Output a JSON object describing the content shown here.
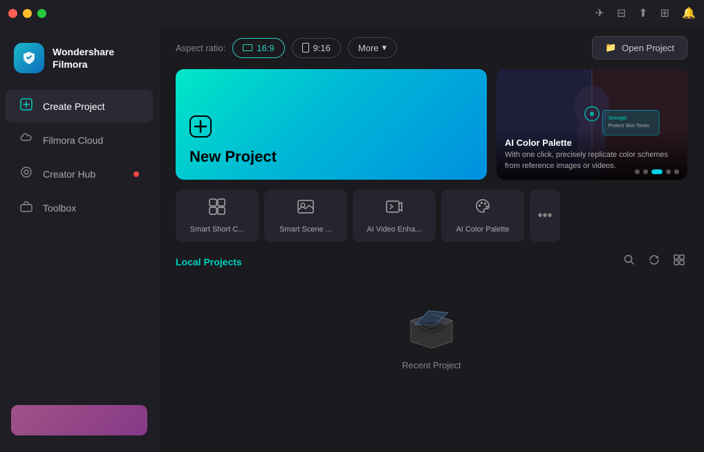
{
  "titlebar": {
    "buttons": [
      "close",
      "minimize",
      "maximize"
    ],
    "icons": [
      "send",
      "message",
      "cloud",
      "grid",
      "bell"
    ]
  },
  "sidebar": {
    "logo": {
      "text_line1": "Wondershare",
      "text_line2": "Filmora"
    },
    "nav_items": [
      {
        "id": "create-project",
        "label": "Create Project",
        "icon": "➕",
        "active": true
      },
      {
        "id": "filmora-cloud",
        "label": "Filmora Cloud",
        "icon": "☁️",
        "active": false
      },
      {
        "id": "creator-hub",
        "label": "Creator Hub",
        "icon": "◎",
        "active": false,
        "has_dot": true
      },
      {
        "id": "toolbox",
        "label": "Toolbox",
        "icon": "🧰",
        "active": false
      }
    ]
  },
  "topbar": {
    "aspect_ratio_label": "Aspect ratio:",
    "btn_169": "16:9",
    "btn_916": "9:16",
    "btn_more": "More",
    "btn_open_project": "Open Project"
  },
  "new_project": {
    "label": "New Project",
    "icon": "⊕"
  },
  "ai_card": {
    "title": "AI Color Palette",
    "description": "With one click, precisely replicate color schemes from reference images or videos.",
    "dots": [
      false,
      false,
      true,
      false,
      false
    ]
  },
  "ai_tools": [
    {
      "id": "smart-short-cut",
      "icon": "⊞",
      "label": "Smart Short C..."
    },
    {
      "id": "smart-scene",
      "icon": "📷",
      "label": "Smart Scene ..."
    },
    {
      "id": "ai-video-enhance",
      "icon": "✨",
      "label": "AI Video Enha..."
    },
    {
      "id": "ai-color-palette",
      "icon": "🎨",
      "label": "AI Color Palette"
    }
  ],
  "local_projects": {
    "title": "Local Projects",
    "empty_label": "Recent Project",
    "actions": [
      "search",
      "refresh",
      "grid-view"
    ]
  }
}
